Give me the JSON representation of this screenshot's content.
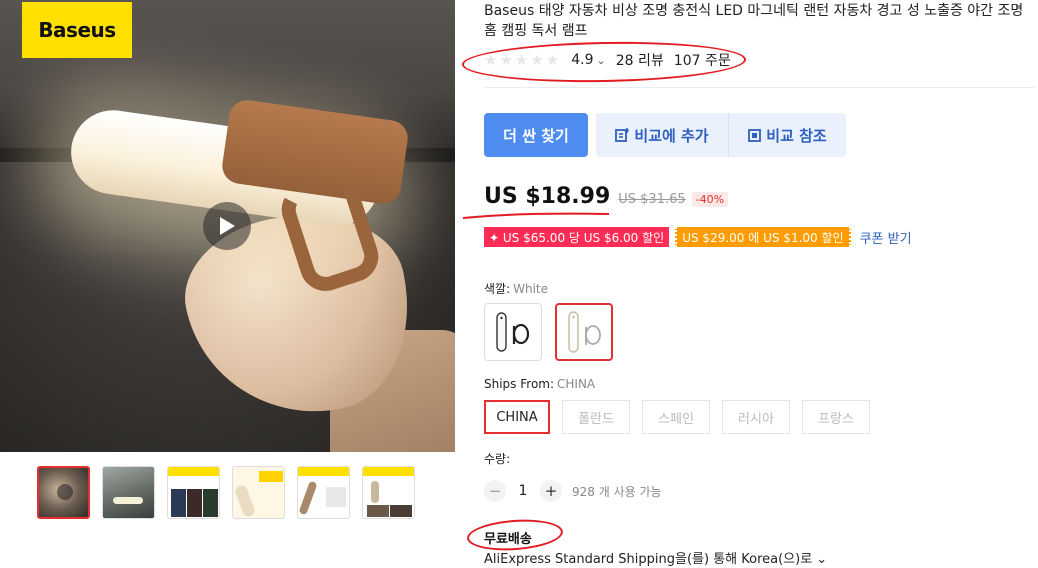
{
  "gallery": {
    "logo_text": "Baseus",
    "thumb_count": 6
  },
  "product": {
    "title": "Baseus 태양 자동차 비상 조명 충전식 LED 마그네틱 랜턴 자동차 경고 성 노출증 야간 조명 홈 캠핑 독서 램프"
  },
  "rating": {
    "score": "4.9",
    "reviews": "28 리뷰",
    "orders": "107 주문"
  },
  "actions": {
    "find_cheaper": "더 싼 찾기",
    "add_compare": "비교에 추가",
    "view_compare": "비교 참조"
  },
  "price": {
    "current": "US $18.99",
    "original": "US $31.65",
    "discount": "-40%"
  },
  "coupons": {
    "coupon_1": "✦ US $65.00 당 US $6.00 할인",
    "coupon_2": "US $29.00 에 US $1.00 할인",
    "get_coupon": "쿠폰 받기"
  },
  "color": {
    "label": "색깔:",
    "value": "White"
  },
  "ships_from": {
    "label": "Ships From:",
    "value": "CHINA",
    "options": [
      "CHINA",
      "폴란드",
      "스페인",
      "러시아",
      "프랑스"
    ]
  },
  "quantity": {
    "label": "수량:",
    "minus": "−",
    "value": "1",
    "plus": "+",
    "available": "928 개 사용 가능"
  },
  "shipping": {
    "free_label": "무료배송",
    "method": "AliExpress Standard Shipping을(를) 통해 Korea(으)로 ⌄"
  },
  "colors": {
    "accent_red": "#e62e2e",
    "primary_blue": "#4e8cf0",
    "coupon_pink": "#ff2d55",
    "coupon_orange": "#ff9c00",
    "annotation_red": "#e31b23"
  }
}
